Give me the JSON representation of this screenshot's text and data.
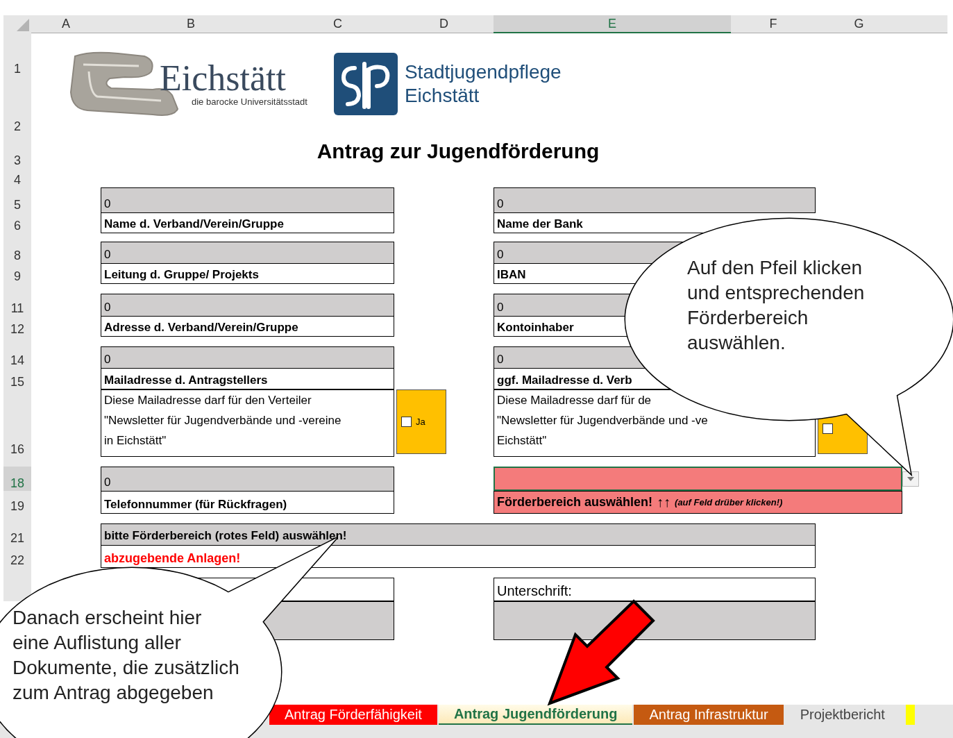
{
  "column_headers": [
    {
      "label": "A",
      "selected": false
    },
    {
      "label": "B",
      "selected": false
    },
    {
      "label": "C",
      "selected": false
    },
    {
      "label": "D",
      "selected": false
    },
    {
      "label": "E",
      "selected": true
    },
    {
      "label": "F",
      "selected": false
    },
    {
      "label": "G",
      "selected": false
    }
  ],
  "row_headers": [
    {
      "label": "1",
      "selected": false
    },
    {
      "label": "2",
      "selected": false
    },
    {
      "label": "3",
      "selected": false
    },
    {
      "label": "4",
      "selected": false
    },
    {
      "label": "5",
      "selected": false
    },
    {
      "label": "6",
      "selected": false
    },
    {
      "label": "8",
      "selected": false
    },
    {
      "label": "9",
      "selected": false
    },
    {
      "label": "11",
      "selected": false
    },
    {
      "label": "12",
      "selected": false
    },
    {
      "label": "14",
      "selected": false
    },
    {
      "label": "15",
      "selected": false
    },
    {
      "label": "16",
      "selected": false
    },
    {
      "label": "18",
      "selected": true
    },
    {
      "label": "19",
      "selected": false
    },
    {
      "label": "21",
      "selected": false
    },
    {
      "label": "22",
      "selected": false
    }
  ],
  "logos": {
    "city": {
      "name": "Eichstätt",
      "tagline": "die barocke Universitätsstadt"
    },
    "org": {
      "lines": [
        "Stadtjugendpflege",
        "Eichstätt"
      ]
    }
  },
  "title": "Antrag zur Jugendförderung",
  "left_fields": [
    {
      "value": "0",
      "label": "Name d. Verband/Verein/Gruppe"
    },
    {
      "value": "0",
      "label": "Leitung d. Gruppe/ Projekts"
    },
    {
      "value": "0",
      "label": "Adresse d. Verband/Verein/Gruppe"
    },
    {
      "value": "0",
      "label": "Mailadresse d. Antragstellers"
    },
    {
      "value": "0",
      "label": "Telefonnummer (für Rückfragen)"
    }
  ],
  "right_fields": [
    {
      "value": "0",
      "label": "Name der Bank"
    },
    {
      "value": "0",
      "label": "IBAN"
    },
    {
      "value": "0",
      "label": "Kontoinhaber"
    },
    {
      "value": "0",
      "label": "ggf. Mailadresse d. Verb"
    }
  ],
  "newsletter": [
    {
      "lines": [
        "Diese Mailadresse darf für den Verteiler",
        "\"Newsletter für Jugendverbände und -vereine",
        "in Eichstätt\""
      ],
      "consent": {
        "label": "Ja",
        "checked": false
      }
    },
    {
      "lines": [
        "Diese Mailadresse darf für de",
        "\"Newsletter für Jugendverbände und -ve",
        "Eichstätt\""
      ],
      "consent": {
        "checked": false
      }
    }
  ],
  "funding_area": {
    "hint": "Förderbereich auswählen!",
    "arrows": "↑↑",
    "note": "(auf Feld drüber klicken!)"
  },
  "notice": "bitte Förderbereich (rotes Feld) auswählen!",
  "attachments_heading": "abzugebende Anlagen!",
  "signature_label": "Unterschrift:",
  "sheet_tabs": [
    {
      "label": "Antrag Förderfähigkeit",
      "color": "#ff0000",
      "selected": false
    },
    {
      "label": "Antrag Jugendförderung",
      "selected": true
    },
    {
      "label": "Antrag Infrastruktur",
      "color": "#c55a11",
      "selected": false
    },
    {
      "label": "Projektbericht",
      "selected": false
    },
    {
      "color": "#ffff00",
      "selected": false
    }
  ],
  "callouts": [
    {
      "text": "Auf den Pfeil klicken und entsprechenden Förderbereich auswählen."
    },
    {
      "text": "Danach erscheint hier eine Auflistung aller Dokumente, die zusätzlich zum Antrag abgegeben"
    }
  ]
}
